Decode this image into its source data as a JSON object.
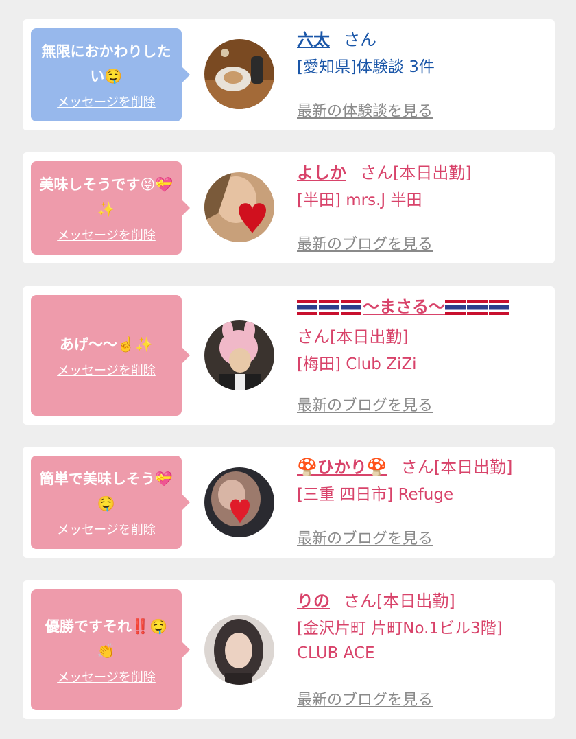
{
  "cards": [
    {
      "bubble_color": "blue",
      "message": "無限におかわりしたい🤤",
      "delete_label": "メッセージを削除",
      "name": "六太",
      "san_suffix": "さん",
      "shop": "[愛知県]体験談 3件",
      "latest_label": "最新の体験談を見る",
      "avatar_icon": "food-photo-avatar"
    },
    {
      "bubble_color": "pink",
      "message": "美味しそうです😝💝✨",
      "delete_label": "メッセージを削除",
      "name": "よしか",
      "san_suffix": "さん[本日出勤]",
      "shop": "[半田] mrs.J 半田",
      "latest_label": "最新のブログを見る",
      "avatar_icon": "heart-photo-avatar"
    },
    {
      "bubble_color": "pink",
      "message": "あげ〜〜☝️✨",
      "delete_label": "メッセージを削除",
      "name": "〜まさる〜",
      "san_suffix": "さん[本日出勤]",
      "shop": "[梅田] Club ZiZi",
      "latest_label": "最新のブログを見る",
      "avatar_icon": "bunny-hat-photo-avatar"
    },
    {
      "bubble_color": "pink",
      "message": "簡単で美味しそう💝🤤",
      "delete_label": "メッセージを削除",
      "name": "🍄ひかり🍄",
      "san_suffix": "さん[本日出勤]",
      "shop": "[三重 四日市] Refuge",
      "latest_label": "最新のブログを見る",
      "avatar_icon": "heart-face-photo-avatar"
    },
    {
      "bubble_color": "pink",
      "message": "優勝ですそれ‼️🤤👏",
      "delete_label": "メッセージを削除",
      "name": "りの",
      "san_suffix": "さん[本日出勤]",
      "shop": "[金沢片町 片町No.1ビル3階] CLUB ACE",
      "latest_label": "最新のブログを見る",
      "avatar_icon": "portrait-photo-avatar"
    }
  ],
  "colors": {
    "blue_bubble": "#97b8ec",
    "pink_bubble": "#ee9bab",
    "blue_text": "#1a56a8",
    "pink_text": "#d8436a",
    "link_gray": "#8a8a8a"
  }
}
